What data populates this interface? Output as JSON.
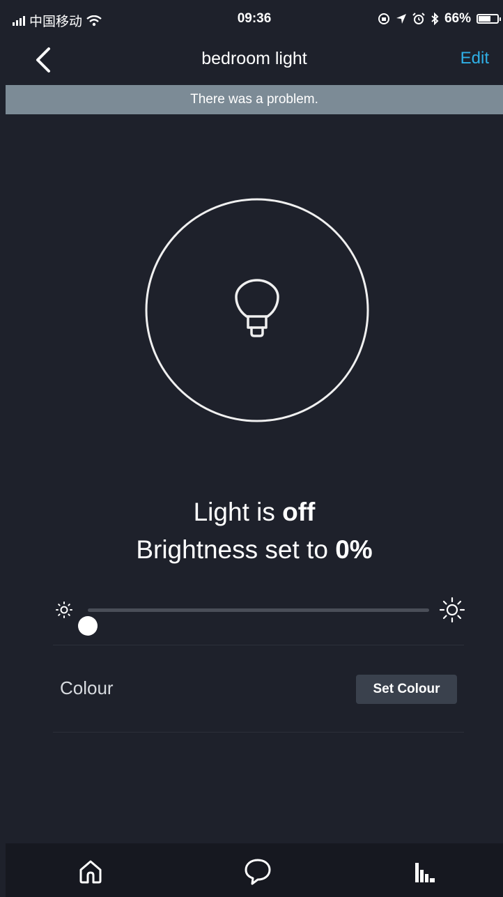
{
  "status_bar": {
    "carrier": "中国移动",
    "time": "09:36",
    "battery_percent": "66%",
    "battery_level": 0.66
  },
  "nav": {
    "title": "bedroom light",
    "edit_label": "Edit"
  },
  "banner": {
    "message": "There was a problem."
  },
  "device": {
    "state_prefix": "Light is ",
    "state_value": "off",
    "brightness_prefix": "Brightness set to ",
    "brightness_value": "0%",
    "brightness_level": 0
  },
  "colour": {
    "label": "Colour",
    "button_label": "Set Colour"
  },
  "colors": {
    "background": "#1e212b",
    "accent": "#2fb0e6",
    "banner": "#7c8b96",
    "button": "#3a414d",
    "tabbar": "#161820"
  },
  "tabs": [
    {
      "icon": "home-icon"
    },
    {
      "icon": "chat-icon"
    },
    {
      "icon": "activity-icon"
    }
  ]
}
